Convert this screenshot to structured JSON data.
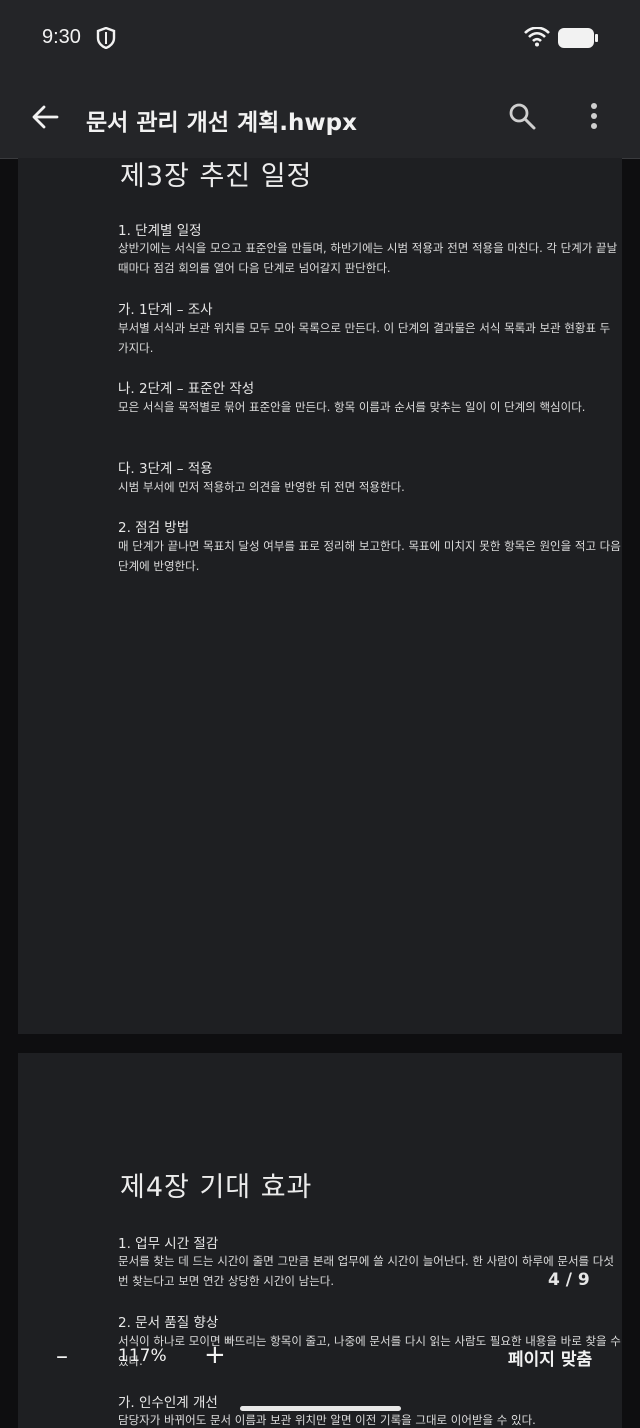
{
  "status": {
    "time": "9:30"
  },
  "appbar": {
    "title": "문서 관리 개선 계획.hwpx"
  },
  "pages": [
    {
      "chapter": "제3장 추진 일정",
      "blocks": [
        {
          "heading": "1. 단계별 일정",
          "text": "상반기에는 서식을 모으고 표준안을 만들며, 하반기에는 시범 적용과 전면 적용을 마친다. 각 단계가 끝날 때마다 점검 회의를 열어 다음 단계로 넘어갈지 판단한다."
        },
        {
          "heading": "가. 1단계 – 조사",
          "text": "부서별 서식과 보관 위치를 모두 모아 목록으로 만든다. 이 단계의 결과물은 서식 목록과 보관 현황표 두 가지다."
        },
        {
          "heading": "나. 2단계 – 표준안 작성",
          "text": "모은 서식을 목적별로 묶어 표준안을 만든다. 항목 이름과 순서를 맞추는 일이 이 단계의 핵심이다."
        },
        {
          "heading": "다. 3단계 – 적용",
          "text": "시범 부서에 먼저 적용하고 의견을 반영한 뒤 전면 적용한다."
        },
        {
          "heading": "2. 점검 방법",
          "text": "매 단계가 끝나면 목표치 달성 여부를 표로 정리해 보고한다. 목표에 미치지 못한 항목은 원인을 적고 다음 단계에 반영한다."
        }
      ]
    },
    {
      "chapter": "제4장 기대 효과",
      "blocks": [
        {
          "heading": "1. 업무 시간 절감",
          "text": "문서를 찾는 데 드는 시간이 줄면 그만큼 본래 업무에 쓸 시간이 늘어난다. 한 사람이 하루에 문서를 다섯 번 찾는다고 보면 연간 상당한 시간이 남는다."
        },
        {
          "heading": "2. 문서 품질 향상",
          "text": "서식이 하나로 모이면 빠뜨리는 항목이 줄고, 나중에 문서를 다시 읽는 사람도 필요한 내용을 바로 찾을 수 있다."
        },
        {
          "heading": "가. 인수인계 개선",
          "text": "담당자가 바뀌어도 문서 이름과 보관 위치만 알면 이전 기록을 그대로 이어받을 수 있다."
        }
      ]
    }
  ],
  "viewer": {
    "page_counter": "4 / 9",
    "zoom_out": "–",
    "zoom": "117%",
    "zoom_in": "+",
    "fit_page": "페이지 맞춤"
  },
  "icons": [
    "shield-icon",
    "wifi-icon",
    "battery-icon",
    "back-arrow-icon",
    "search-icon",
    "more-vert-icon"
  ]
}
